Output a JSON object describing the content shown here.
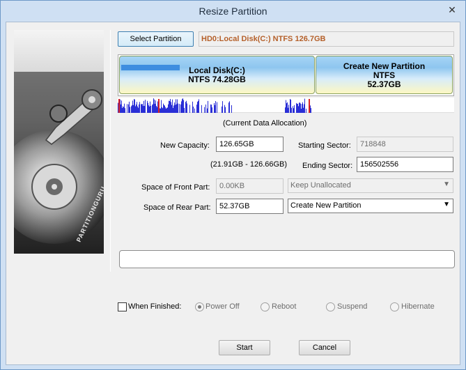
{
  "window": {
    "title": "Resize Partition"
  },
  "side_image": {
    "brand_text": "PARTITIONGURU"
  },
  "toolbar": {
    "select_partition_label": "Select Partition",
    "partition_path": "HD0:Local Disk(C:) NTFS 126.7GB"
  },
  "disk_map": {
    "partitions": [
      {
        "name": "Local Disk(C:)",
        "info": "NTFS 74.28GB",
        "used_fraction": 0.3
      },
      {
        "name": "Create New Partition",
        "fs": "NTFS",
        "size": "52.37GB",
        "used_fraction": 0.0
      }
    ],
    "allocation_caption": "(Current Data Allocation)",
    "used_color": "#2a2fd6"
  },
  "form": {
    "new_capacity_label": "New Capacity:",
    "new_capacity_value": "126.65GB",
    "range_text": "(21.91GB - 126.66GB)",
    "starting_sector_label": "Starting Sector:",
    "starting_sector_value": "718848",
    "ending_sector_label": "Ending Sector:",
    "ending_sector_value": "156502556",
    "front_space_label": "Space of Front Part:",
    "front_space_value": "0.00KB",
    "front_action": "Keep Unallocated",
    "rear_space_label": "Space of Rear Part:",
    "rear_space_value": "52.37GB",
    "rear_action": "Create New Partition"
  },
  "progress": {
    "value_percent": 0
  },
  "when_finished": {
    "label": "When Finished:",
    "checked": false,
    "options": [
      "Power Off",
      "Reboot",
      "Suspend",
      "Hibernate"
    ],
    "selected": "Power Off"
  },
  "buttons": {
    "start_label": "Start",
    "cancel_label": "Cancel"
  },
  "colors": {
    "accent": "#3c7fb1",
    "path_text": "#b5602a",
    "progress": "#06b025"
  }
}
